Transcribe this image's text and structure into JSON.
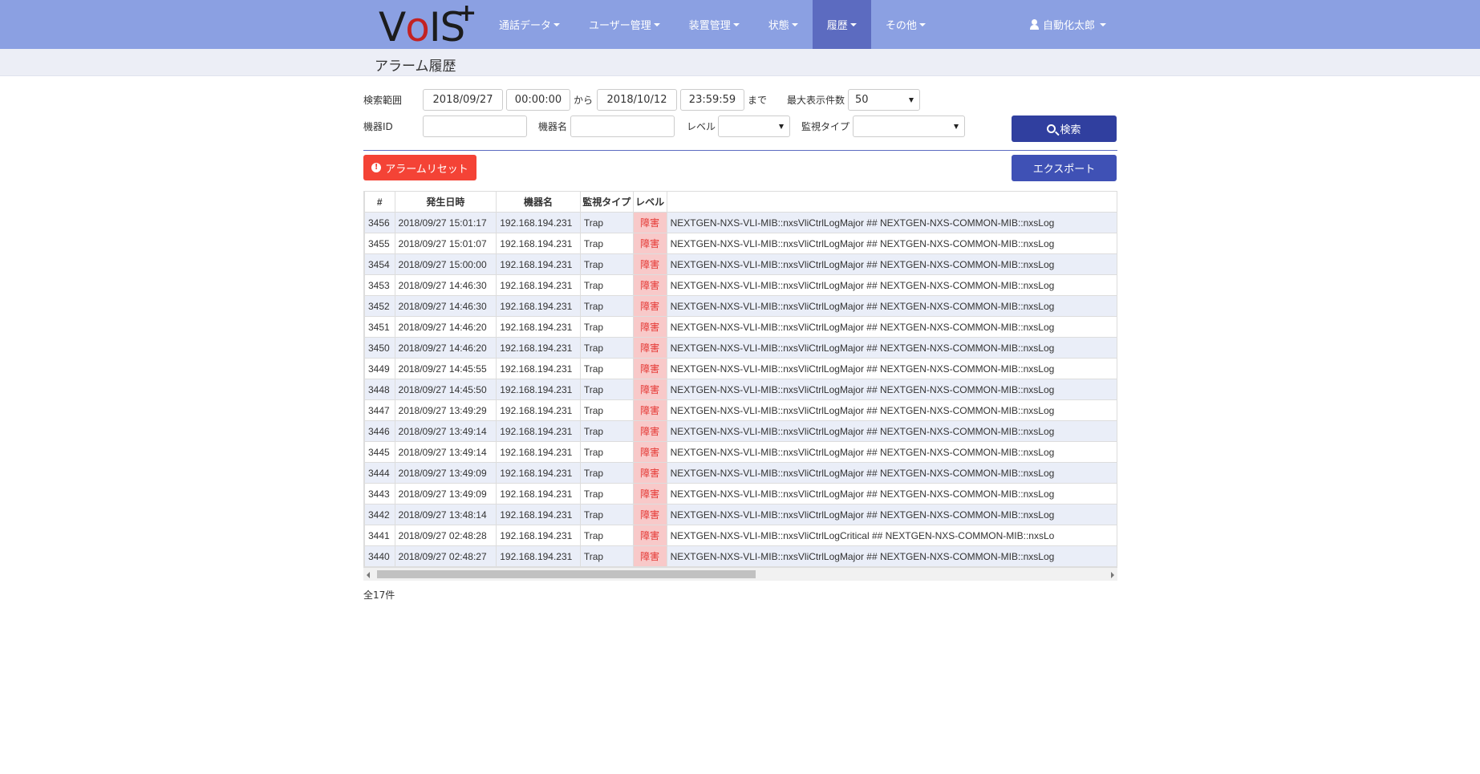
{
  "nav": {
    "logo": {
      "v": "V",
      "o": "o",
      "is": "IS",
      "plus": "+"
    },
    "items": [
      {
        "label": "通話データ"
      },
      {
        "label": "ユーザー管理"
      },
      {
        "label": "装置管理"
      },
      {
        "label": "状態"
      },
      {
        "label": "履歴",
        "active": true
      },
      {
        "label": "その他"
      }
    ],
    "user": "自動化太郎"
  },
  "page_title": "アラーム履歴",
  "form": {
    "range_label": "検索範囲",
    "date_from": "2018/09/27",
    "time_from": "00:00:00",
    "from_text": "から",
    "date_to": "2018/10/12",
    "time_to": "23:59:59",
    "to_text": "まで",
    "max_label": "最大表示件数",
    "max_value": "50",
    "device_id_label": "機器ID",
    "device_id_value": "",
    "device_name_label": "機器名",
    "device_name_value": "",
    "level_label": "レベル",
    "level_value": "",
    "monitor_type_label": "監視タイプ",
    "monitor_type_value": "",
    "search_button": "検索",
    "reset_button": "アラームリセット",
    "export_button": "エクスポート"
  },
  "table": {
    "headers": [
      "#",
      "発生日時",
      "機器名",
      "監視タイプ",
      "レベル",
      ""
    ],
    "rows": [
      [
        "3456",
        "2018/09/27 15:01:17",
        "192.168.194.231",
        "Trap",
        "障害",
        "NEXTGEN-NXS-VLI-MIB::nxsVliCtrlLogMajor ## NEXTGEN-NXS-COMMON-MIB::nxsLog"
      ],
      [
        "3455",
        "2018/09/27 15:01:07",
        "192.168.194.231",
        "Trap",
        "障害",
        "NEXTGEN-NXS-VLI-MIB::nxsVliCtrlLogMajor ## NEXTGEN-NXS-COMMON-MIB::nxsLog"
      ],
      [
        "3454",
        "2018/09/27 15:00:00",
        "192.168.194.231",
        "Trap",
        "障害",
        "NEXTGEN-NXS-VLI-MIB::nxsVliCtrlLogMajor ## NEXTGEN-NXS-COMMON-MIB::nxsLog"
      ],
      [
        "3453",
        "2018/09/27 14:46:30",
        "192.168.194.231",
        "Trap",
        "障害",
        "NEXTGEN-NXS-VLI-MIB::nxsVliCtrlLogMajor ## NEXTGEN-NXS-COMMON-MIB::nxsLog"
      ],
      [
        "3452",
        "2018/09/27 14:46:30",
        "192.168.194.231",
        "Trap",
        "障害",
        "NEXTGEN-NXS-VLI-MIB::nxsVliCtrlLogMajor ## NEXTGEN-NXS-COMMON-MIB::nxsLog"
      ],
      [
        "3451",
        "2018/09/27 14:46:20",
        "192.168.194.231",
        "Trap",
        "障害",
        "NEXTGEN-NXS-VLI-MIB::nxsVliCtrlLogMajor ## NEXTGEN-NXS-COMMON-MIB::nxsLog"
      ],
      [
        "3450",
        "2018/09/27 14:46:20",
        "192.168.194.231",
        "Trap",
        "障害",
        "NEXTGEN-NXS-VLI-MIB::nxsVliCtrlLogMajor ## NEXTGEN-NXS-COMMON-MIB::nxsLog"
      ],
      [
        "3449",
        "2018/09/27 14:45:55",
        "192.168.194.231",
        "Trap",
        "障害",
        "NEXTGEN-NXS-VLI-MIB::nxsVliCtrlLogMajor ## NEXTGEN-NXS-COMMON-MIB::nxsLog"
      ],
      [
        "3448",
        "2018/09/27 14:45:50",
        "192.168.194.231",
        "Trap",
        "障害",
        "NEXTGEN-NXS-VLI-MIB::nxsVliCtrlLogMajor ## NEXTGEN-NXS-COMMON-MIB::nxsLog"
      ],
      [
        "3447",
        "2018/09/27 13:49:29",
        "192.168.194.231",
        "Trap",
        "障害",
        "NEXTGEN-NXS-VLI-MIB::nxsVliCtrlLogMajor ## NEXTGEN-NXS-COMMON-MIB::nxsLog"
      ],
      [
        "3446",
        "2018/09/27 13:49:14",
        "192.168.194.231",
        "Trap",
        "障害",
        "NEXTGEN-NXS-VLI-MIB::nxsVliCtrlLogMajor ## NEXTGEN-NXS-COMMON-MIB::nxsLog"
      ],
      [
        "3445",
        "2018/09/27 13:49:14",
        "192.168.194.231",
        "Trap",
        "障害",
        "NEXTGEN-NXS-VLI-MIB::nxsVliCtrlLogMajor ## NEXTGEN-NXS-COMMON-MIB::nxsLog"
      ],
      [
        "3444",
        "2018/09/27 13:49:09",
        "192.168.194.231",
        "Trap",
        "障害",
        "NEXTGEN-NXS-VLI-MIB::nxsVliCtrlLogMajor ## NEXTGEN-NXS-COMMON-MIB::nxsLog"
      ],
      [
        "3443",
        "2018/09/27 13:49:09",
        "192.168.194.231",
        "Trap",
        "障害",
        "NEXTGEN-NXS-VLI-MIB::nxsVliCtrlLogMajor ## NEXTGEN-NXS-COMMON-MIB::nxsLog"
      ],
      [
        "3442",
        "2018/09/27 13:48:14",
        "192.168.194.231",
        "Trap",
        "障害",
        "NEXTGEN-NXS-VLI-MIB::nxsVliCtrlLogMajor ## NEXTGEN-NXS-COMMON-MIB::nxsLog"
      ],
      [
        "3441",
        "2018/09/27 02:48:28",
        "192.168.194.231",
        "Trap",
        "障害",
        "NEXTGEN-NXS-VLI-MIB::nxsVliCtrlLogCritical ## NEXTGEN-NXS-COMMON-MIB::nxsLo"
      ],
      [
        "3440",
        "2018/09/27 02:48:27",
        "192.168.194.231",
        "Trap",
        "障害",
        "NEXTGEN-NXS-VLI-MIB::nxsVliCtrlLogMajor ## NEXTGEN-NXS-COMMON-MIB::nxsLog"
      ]
    ]
  },
  "total_text": "全17件",
  "colors": {
    "navbar": "#8ba0e2",
    "active_nav": "#5c6bc0",
    "search_button": "#303f9f",
    "export_button": "#3f51b5",
    "reset_button": "#f44336",
    "level_cell_bg": "#f8c9c9",
    "level_text": "#e53935"
  }
}
